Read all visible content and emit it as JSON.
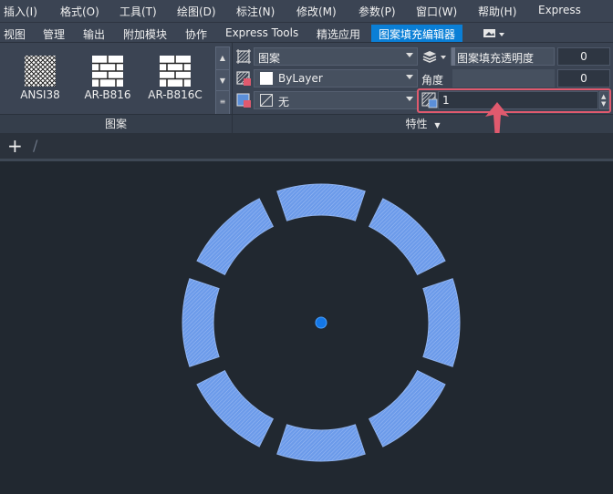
{
  "menu": {
    "items": [
      "插入(I)",
      "格式(O)",
      "工具(T)",
      "绘图(D)",
      "标注(N)",
      "修改(M)",
      "参数(P)",
      "窗口(W)",
      "帮助(H)",
      "Express"
    ]
  },
  "tabs": {
    "items": [
      "视图",
      "管理",
      "输出",
      "附加模块",
      "协作",
      "Express Tools",
      "精选应用",
      "图案填充编辑器"
    ],
    "active_index": 7
  },
  "pattern_panel": {
    "swatches": [
      "ANSI38",
      "AR-B816",
      "AR-B816C"
    ],
    "title": "图案"
  },
  "properties_panel": {
    "hatch_type": "图案",
    "hatch_color": "ByLayer",
    "background_color": "无",
    "transparency_label": "图案填充透明度",
    "transparency_value": "0",
    "angle_label": "角度",
    "angle_value": "0",
    "scale_value": "1",
    "title": "特性"
  },
  "colors": {
    "accent": "#0a7fd6",
    "highlight": "#e05a6e",
    "hatch_fill": "#6c9bea",
    "center_point": "#1477e6"
  },
  "drawing": {
    "ring_segments": 8,
    "center_marker": true
  }
}
